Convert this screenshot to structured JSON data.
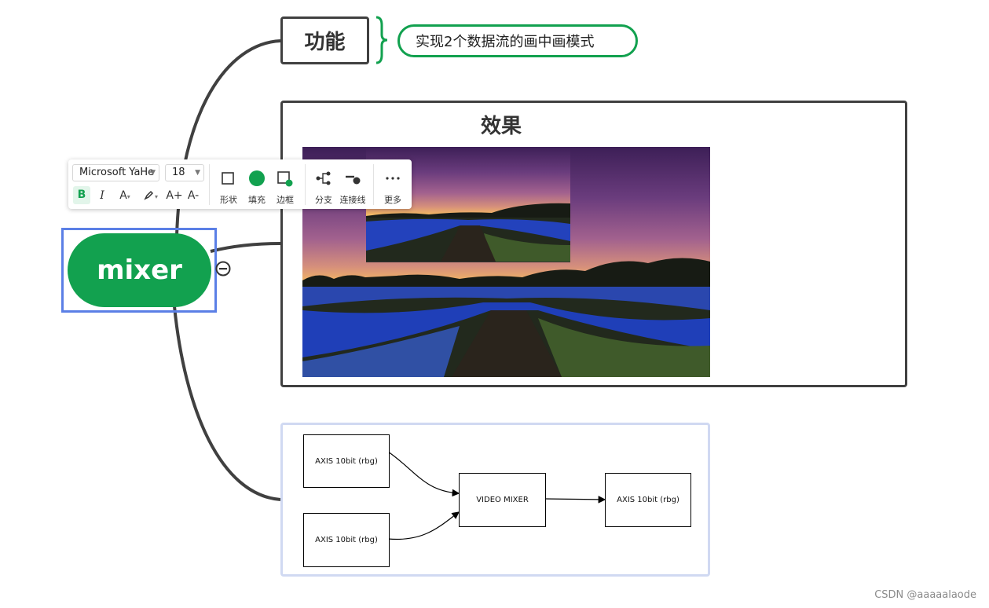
{
  "mindmap": {
    "central_topic": "mixer",
    "feature_topic": "功能",
    "feature_note": "实现2个数据流的画中画模式",
    "effect_topic": "效果"
  },
  "toolbar": {
    "font_family": "Microsoft YaHe",
    "font_size": "18",
    "bold": "B",
    "italic": "I",
    "font_color": "A",
    "grow_font": "A+",
    "shrink_font": "A-",
    "shape_label": "形状",
    "fill_label": "填充",
    "border_label": "边框",
    "branch_label": "分支",
    "connector_label": "连接线",
    "more_label": "更多"
  },
  "diagram": {
    "input_1": "AXIS 10bit (rbg)",
    "input_2": "AXIS 10bit (rbg)",
    "mixer": "VIDEO MIXER",
    "output": "AXIS 10bit (rbg)"
  },
  "colors": {
    "accent_green": "#12a14f",
    "selection_blue": "#5b7fe6",
    "branch_gray": "#404040",
    "frame_blue": "#d0d9f2"
  },
  "watermark": "CSDN @aaaaalaode"
}
